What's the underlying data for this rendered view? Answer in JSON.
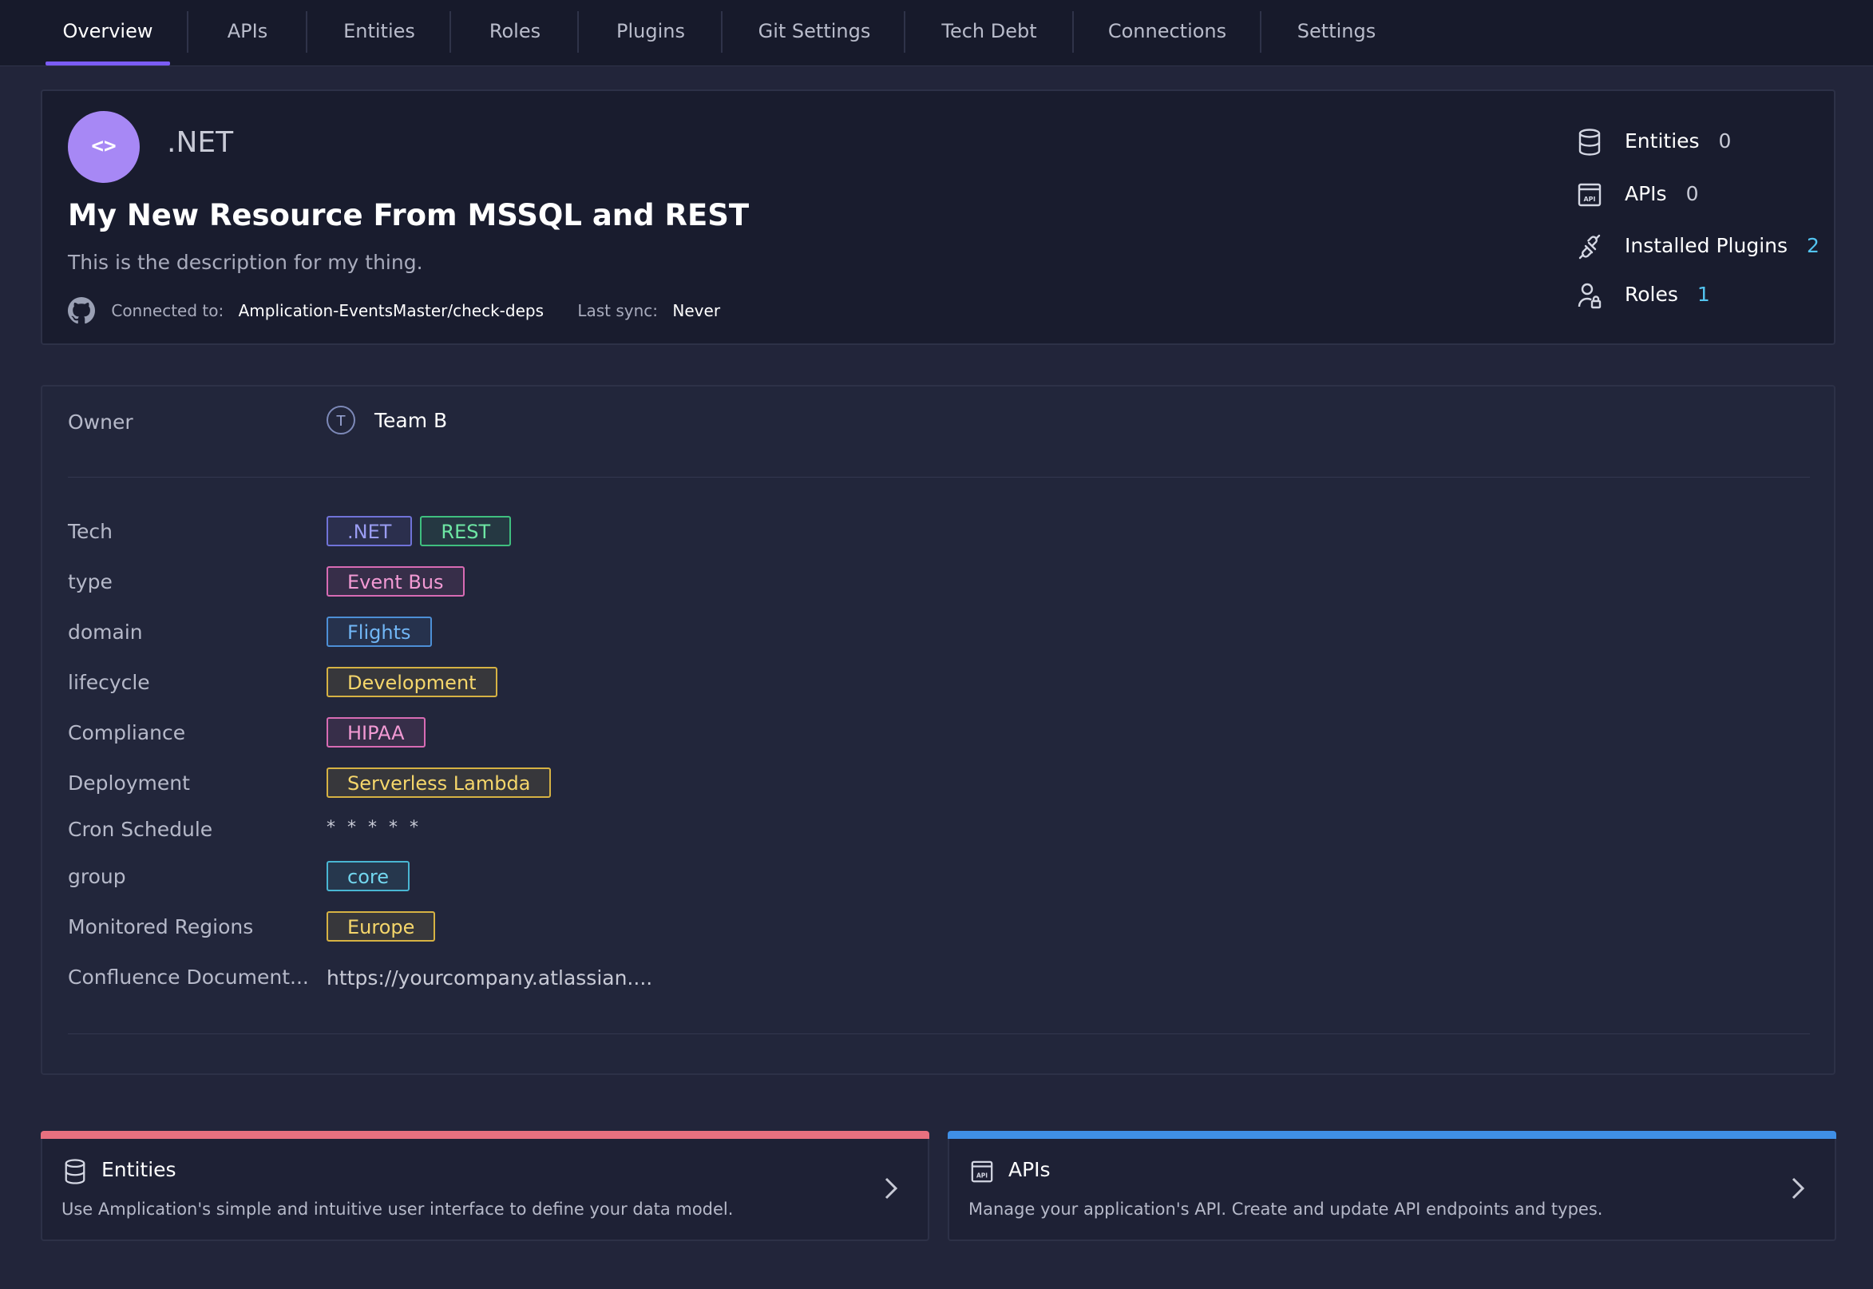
{
  "tabs": [
    {
      "label": "Overview",
      "active": true
    },
    {
      "label": "APIs"
    },
    {
      "label": "Entities"
    },
    {
      "label": "Roles"
    },
    {
      "label": "Plugins"
    },
    {
      "label": "Git Settings"
    },
    {
      "label": "Tech Debt"
    },
    {
      "label": "Connections"
    },
    {
      "label": "Settings"
    }
  ],
  "header": {
    "logo_glyph": "<>",
    "tech": ".NET",
    "title": "My New Resource From MSSQL and REST",
    "description": "This is the description for my thing.",
    "connected_label": "Connected to:",
    "connected_repo": "Amplication-EventsMaster/check-deps",
    "last_sync_label": "Last sync:",
    "last_sync_value": "Never",
    "icon": "github-icon"
  },
  "stats": [
    {
      "label": "Entities",
      "value": "0",
      "icon": "database-icon",
      "highlight": false
    },
    {
      "label": "APIs",
      "value": "0",
      "icon": "api-icon",
      "highlight": false
    },
    {
      "label": "Installed Plugins",
      "value": "2",
      "icon": "plug-icon",
      "highlight": true
    },
    {
      "label": "Roles",
      "value": "1",
      "icon": "user-lock-icon",
      "highlight": true
    }
  ],
  "owner": {
    "label": "Owner",
    "initial": "T",
    "name": "Team B"
  },
  "properties": {
    "tech": {
      "label": "Tech",
      "tags": [
        ".NET",
        "REST"
      ]
    },
    "type": {
      "label": "type",
      "tags": [
        "Event Bus"
      ]
    },
    "domain": {
      "label": "domain",
      "tags": [
        "Flights"
      ]
    },
    "lifecycle": {
      "label": "lifecycle",
      "tags": [
        "Development"
      ]
    },
    "compliance": {
      "label": "Compliance",
      "tags": [
        "HIPAA"
      ]
    },
    "deployment": {
      "label": "Deployment",
      "tags": [
        "Serverless Lambda"
      ]
    },
    "cron": {
      "label": "Cron Schedule",
      "value": "* * * * *"
    },
    "group": {
      "label": "group",
      "tags": [
        "core"
      ]
    },
    "regions": {
      "label": "Monitored Regions",
      "tags": [
        "Europe"
      ]
    },
    "confluence": {
      "label": "Confluence Document...",
      "value": "https://yourcompany.atlassian...."
    }
  },
  "cards": [
    {
      "title": "Entities",
      "description": "Use Amplication's simple and intuitive user interface to define your data model.",
      "icon": "database-icon",
      "accent": "#e8707f"
    },
    {
      "title": "APIs",
      "description": "Manage your application's API. Create and update API endpoints and types.",
      "icon": "api-icon",
      "accent": "#3f8fe6"
    }
  ],
  "colors": {
    "accent": "#7b5cf5",
    "background": "#22253a",
    "link": "#53c4f0"
  }
}
